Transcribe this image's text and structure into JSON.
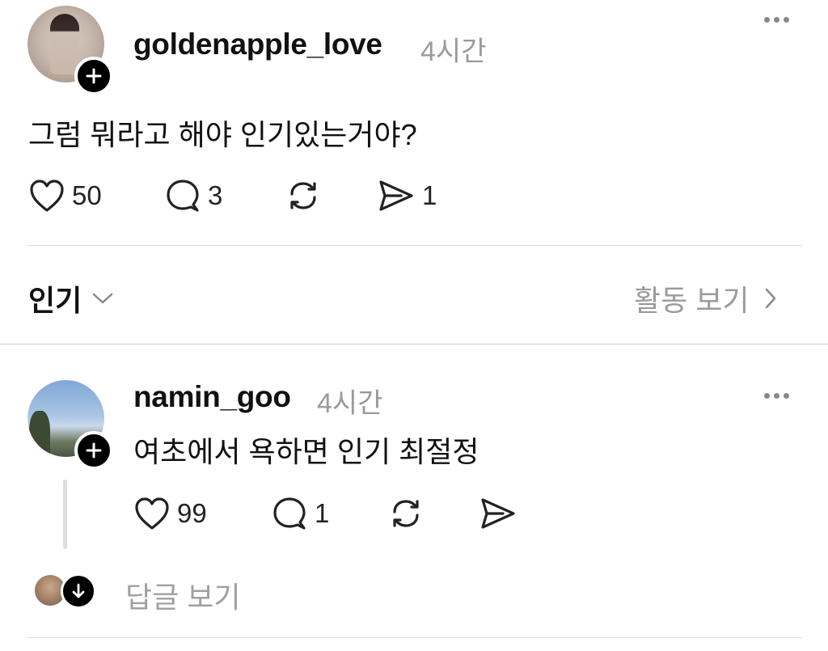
{
  "post": {
    "username": "goldenapple_love",
    "time": "4시간",
    "text": "그럼 뭐라고 해야 인기있는거야?",
    "likes": "50",
    "comments": "3",
    "shares": "1"
  },
  "sort": {
    "label": "인기",
    "activity_label": "활동 보기"
  },
  "reply": {
    "username": "namin_goo",
    "time": "4시간",
    "text": "여초에서 욕하면 인기 최절정",
    "likes": "99",
    "comments": "1"
  },
  "view_replies_label": "답글 보기",
  "icons": [
    "more-icon",
    "heart-icon",
    "comment-icon",
    "repost-icon",
    "share-icon",
    "chevron-down-icon",
    "chevron-right-icon",
    "plus-icon",
    "arrow-down-icon"
  ]
}
